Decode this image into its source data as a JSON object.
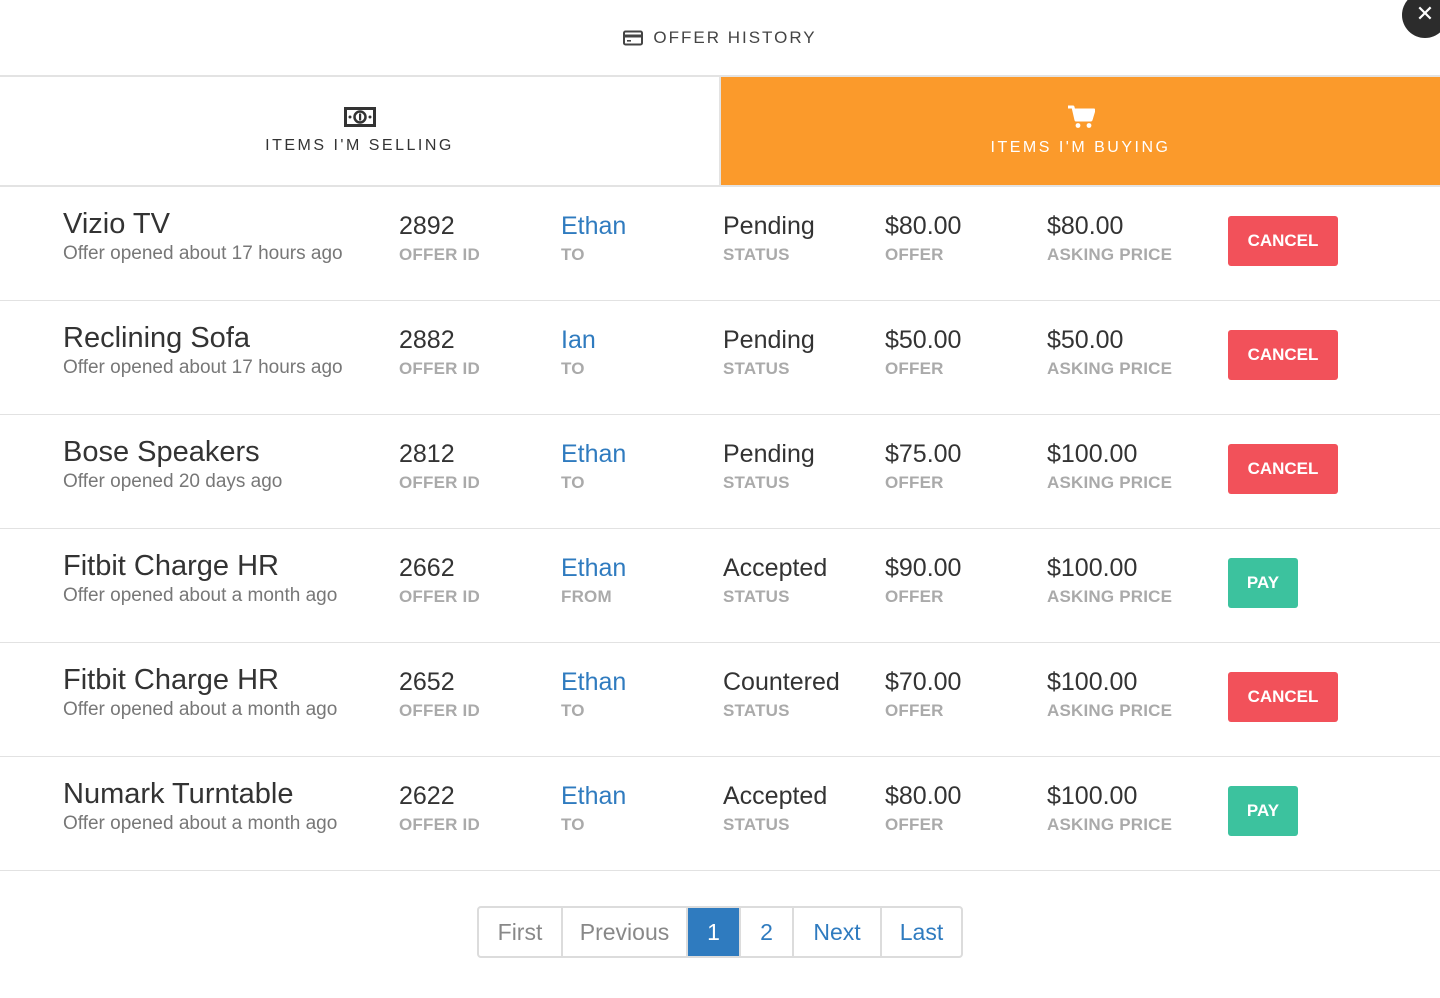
{
  "header": {
    "title": "OFFER HISTORY",
    "icon": "credit-card-icon"
  },
  "close": {
    "label": "✕"
  },
  "tabs": [
    {
      "label": "ITEMS I'M SELLING",
      "icon": "money-icon",
      "active": false
    },
    {
      "label": "ITEMS I'M BUYING",
      "icon": "cart-icon",
      "active": true
    }
  ],
  "labels": {
    "offer_id": "OFFER ID",
    "status": "STATUS",
    "offer": "OFFER",
    "asking_price": "ASKING PRICE"
  },
  "offers": [
    {
      "item": "Vizio TV",
      "opened": "Offer opened about 17 hours ago",
      "id": "2892",
      "party": "Ethan",
      "direction": "TO",
      "status": "Pending",
      "offer": "$80.00",
      "asking": "$80.00",
      "action": "CANCEL"
    },
    {
      "item": "Reclining Sofa",
      "opened": "Offer opened about 17 hours ago",
      "id": "2882",
      "party": "Ian",
      "direction": "TO",
      "status": "Pending",
      "offer": "$50.00",
      "asking": "$50.00",
      "action": "CANCEL"
    },
    {
      "item": "Bose Speakers",
      "opened": "Offer opened 20 days ago",
      "id": "2812",
      "party": "Ethan",
      "direction": "TO",
      "status": "Pending",
      "offer": "$75.00",
      "asking": "$100.00",
      "action": "CANCEL"
    },
    {
      "item": "Fitbit Charge HR",
      "opened": "Offer opened about a month ago",
      "id": "2662",
      "party": "Ethan",
      "direction": "FROM",
      "status": "Accepted",
      "offer": "$90.00",
      "asking": "$100.00",
      "action": "PAY"
    },
    {
      "item": "Fitbit Charge HR",
      "opened": "Offer opened about a month ago",
      "id": "2652",
      "party": "Ethan",
      "direction": "TO",
      "status": "Countered",
      "offer": "$70.00",
      "asking": "$100.00",
      "action": "CANCEL"
    },
    {
      "item": "Numark Turntable",
      "opened": "Offer opened about a month ago",
      "id": "2622",
      "party": "Ethan",
      "direction": "TO",
      "status": "Accepted",
      "offer": "$80.00",
      "asking": "$100.00",
      "action": "PAY"
    }
  ],
  "pagination": {
    "first": "First",
    "previous": "Previous",
    "pages": [
      "1",
      "2"
    ],
    "current": "1",
    "next": "Next",
    "last": "Last"
  },
  "colors": {
    "accent_orange": "#fb9a2b",
    "cancel_red": "#f2515a",
    "pay_green": "#3cc29e",
    "link_blue": "#2f7bbf"
  }
}
